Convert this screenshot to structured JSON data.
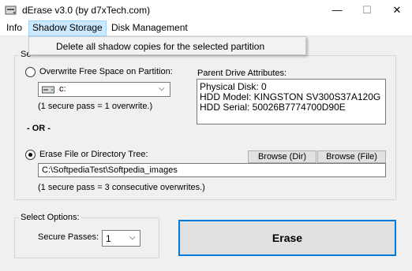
{
  "window": {
    "title": "dErase  v3.0 (by d7xTech.com)",
    "minimize": "—",
    "maximize": "☐",
    "close": "✕"
  },
  "menu": {
    "items": [
      "Info",
      "Shadow Storage",
      "Disk Management"
    ],
    "dropdown_item": "Delete all shadow copies for the selected partition"
  },
  "group_label_partial": "Se",
  "free_space": {
    "label": "Overwrite Free Space on Partition:",
    "drive": "c:",
    "note": "(1 secure pass = 1 overwrite.)"
  },
  "parent_drive": {
    "label": "Parent Drive Attributes:",
    "lines": [
      "Physical Disk:  0",
      "HDD Model:  KINGSTON SV300S37A120G",
      "HDD Serial:  50026B7774700D90E"
    ]
  },
  "or_label": "- OR -",
  "file_tree": {
    "label": "Erase File or Directory Tree:",
    "browse_dir": "Browse (Dir)",
    "browse_file": "Browse (File)",
    "path": "C:\\SoftpediaTest\\Softpedia_images",
    "note": "(1 secure pass = 3 consecutive overwrites.)"
  },
  "select_options": {
    "label": "Select Options:",
    "secure_passes_label": "Secure Passes:",
    "secure_passes_value": "1"
  },
  "erase_button": "Erase",
  "selected_mode": "file_tree",
  "colors": {
    "accent": "#0078d7",
    "menu_highlight": "#cce8ff"
  }
}
